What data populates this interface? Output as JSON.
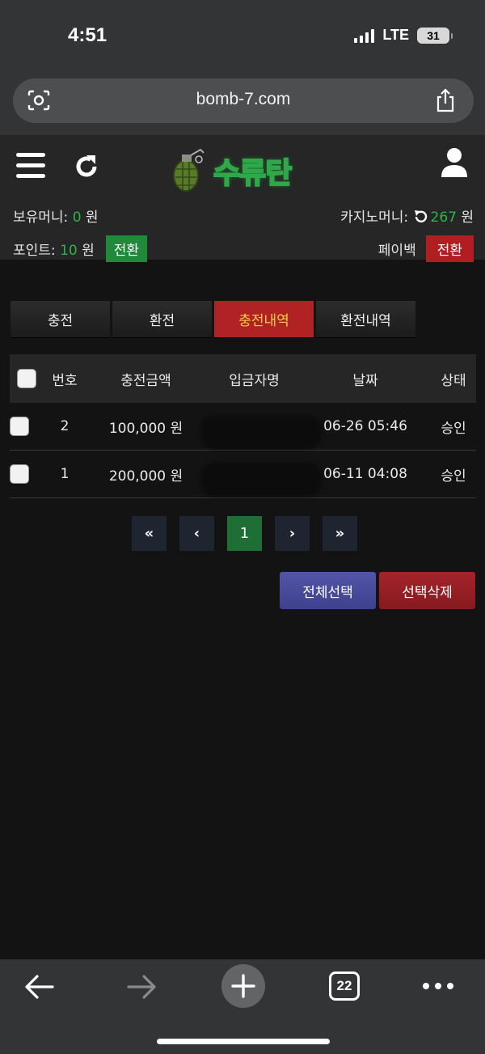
{
  "status_bar": {
    "time": "4:51",
    "network": "LTE",
    "battery": "31"
  },
  "browser": {
    "url": "bomb-7.com",
    "tab_count": "22"
  },
  "site": {
    "logo_text": "수류탄",
    "balance_label": "보유머니: ",
    "balance_value": "0",
    "balance_unit": " 원",
    "casino_label": "카지노머니: ",
    "casino_value": "267",
    "casino_unit": " 원",
    "points_label": "포인트: ",
    "points_value": "10",
    "points_unit": " 원",
    "convert_label": "전환",
    "payback_label": "페이백",
    "payback_convert_label": "전환"
  },
  "tabs": [
    {
      "label": "충전",
      "active": false
    },
    {
      "label": "환전",
      "active": false
    },
    {
      "label": "충전내역",
      "active": true
    },
    {
      "label": "환전내역",
      "active": false
    }
  ],
  "table": {
    "columns": [
      "번호",
      "충전금액",
      "입금자명",
      "날짜",
      "상태"
    ],
    "rows": [
      {
        "no": "2",
        "amount": "100,000 원",
        "depositor": "",
        "date": "06-26 05:46",
        "status": "승인"
      },
      {
        "no": "1",
        "amount": "200,000 원",
        "depositor": "",
        "date": "06-11 04:08",
        "status": "승인"
      }
    ]
  },
  "pagination": {
    "first": "«",
    "prev": "‹",
    "current": "1",
    "next": "›",
    "last": "»"
  },
  "actions": {
    "select_all": "전체선택",
    "delete_selected": "선택삭제"
  },
  "colors": {
    "accent_green": "#2fb24a",
    "accent_red": "#b02224",
    "active_tab_text": "#f1d045",
    "select_button": "#4a4d9e"
  }
}
